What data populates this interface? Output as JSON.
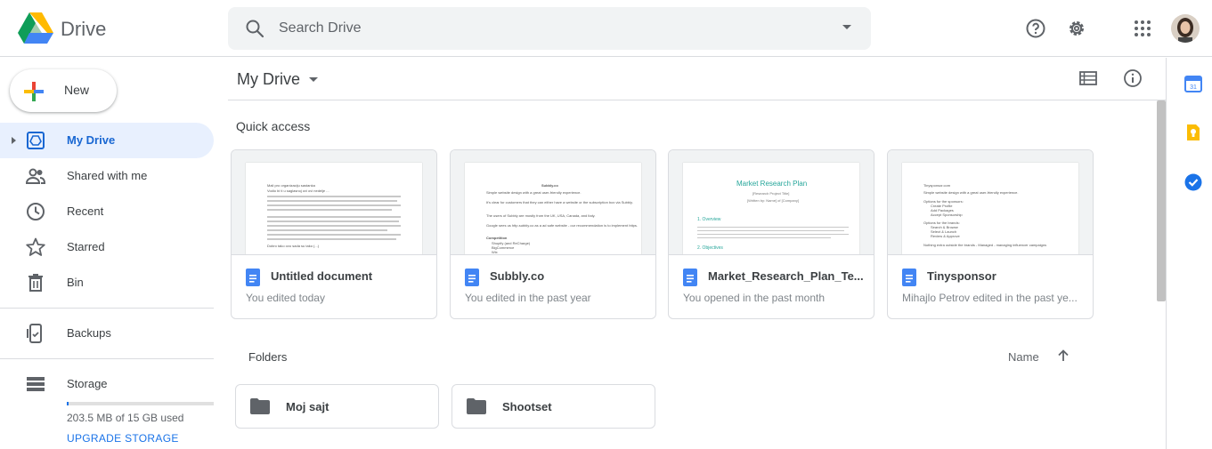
{
  "app": {
    "title": "Drive"
  },
  "search": {
    "placeholder": "Search Drive"
  },
  "header_icons": [
    "help-icon",
    "settings-icon",
    "apps-icon",
    "account-avatar"
  ],
  "sidebar": {
    "new_label": "New",
    "items": [
      {
        "label": "My Drive",
        "icon": "my-drive-icon",
        "active": true
      },
      {
        "label": "Shared with me",
        "icon": "people-icon"
      },
      {
        "label": "Recent",
        "icon": "clock-icon"
      },
      {
        "label": "Starred",
        "icon": "star-icon"
      },
      {
        "label": "Bin",
        "icon": "trash-icon"
      },
      {
        "label": "Backups",
        "icon": "backup-phone-icon"
      },
      {
        "label": "Storage",
        "icon": "storage-icon"
      }
    ],
    "storage": {
      "used_text": "203.5 MB of 15 GB used",
      "used_fraction": 0.0136,
      "upgrade_label": "UPGRADE STORAGE"
    }
  },
  "main": {
    "title": "My Drive",
    "quick_access_label": "Quick access",
    "quick_access": [
      {
        "name": "Untitled document",
        "sub": "You edited today",
        "preview": [
          "Mali pro organizaciju sastanka",
          "Vodio bi ti u saglasnoj ovi ovi nedelje ...",
          "Dobro tako ovo sada su tako (...)"
        ]
      },
      {
        "name": "Subbly.co",
        "sub": "You edited in the past year",
        "preview": [
          "Subbly.co",
          "Simple website design with a great user-friendly experience.",
          "It's clear for customers that they can either have a website or the subscription box via Subbly.",
          "The users of Subbly are mostly from the UK, USA, Canada, and Italy.",
          "Google sees us http.subbly.co as a ad safe website - our recommendation is to implement https.",
          "Competition",
          "Shopify (and ReCharge)",
          "BigCommerce",
          "Wix"
        ]
      },
      {
        "name": "Market_Research_Plan_Te...",
        "sub": "You opened in the past month",
        "preview": [
          "Market Research Plan",
          "[Research Project Title]",
          "[Written by: Name] of [Company]",
          "1. Overview",
          "2. Objectives"
        ]
      },
      {
        "name": "Tinysponsor",
        "sub": "Mihajlo Petrov edited in the past ye...",
        "preview": [
          "Tinysponsor.com",
          "Simple website design with a great user-friendly experience.",
          "Options for the sponsors:",
          "Create Profile",
          "Add Packages",
          "Accept Sponsorship",
          "Options for the brands:",
          "Search & Browse",
          "Select & Launch",
          "Review & Approve",
          "Nothing extra outside the brands - Managed - managing influencer campaigns"
        ]
      }
    ],
    "folders_label": "Folders",
    "sort": {
      "label": "Name"
    },
    "folders": [
      {
        "name": "Moj sajt"
      },
      {
        "name": "Shootset"
      }
    ]
  },
  "side_panel": [
    "calendar-icon",
    "keep-icon",
    "tasks-icon"
  ],
  "colors": {
    "accent": "#1a73e8",
    "active_bg": "#e8f0fe",
    "doc_blue": "#4285f4"
  }
}
